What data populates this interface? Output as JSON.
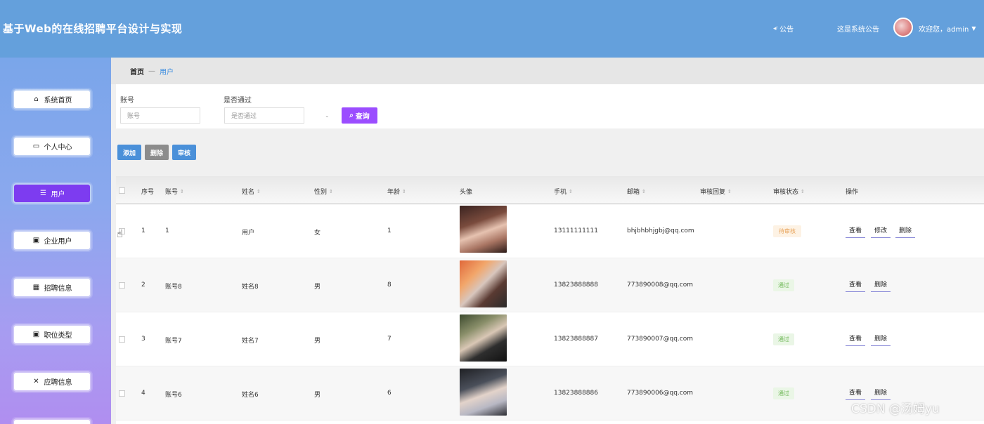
{
  "header": {
    "app_title": "基于Web的在线招聘平台设计与实现",
    "notice_label": "公告",
    "notice_text": "这是系统公告",
    "welcome": "欢迎您，admin"
  },
  "sidebar": {
    "items": [
      {
        "label": "系统首页",
        "icon": "home-icon"
      },
      {
        "label": "个人中心",
        "icon": "card-icon"
      },
      {
        "label": "用户",
        "icon": "menu-icon"
      },
      {
        "label": "企业用户",
        "icon": "clipboard-icon"
      },
      {
        "label": "招聘信息",
        "icon": "grid-icon"
      },
      {
        "label": "职位类型",
        "icon": "clipboard-icon"
      },
      {
        "label": "应聘信息",
        "icon": "ticket-icon"
      }
    ]
  },
  "breadcrumb": {
    "home": "首页",
    "separator": "—",
    "current": "用户"
  },
  "search": {
    "account_label": "账号",
    "account_placeholder": "账号",
    "passed_label": "是否通过",
    "passed_placeholder": "是否通过",
    "search_button": "查询"
  },
  "actions": {
    "add": "添加",
    "delete": "删除",
    "audit": "审核"
  },
  "table": {
    "columns": [
      "序号",
      "账号",
      "姓名",
      "性别",
      "年龄",
      "头像",
      "手机",
      "邮箱",
      "审核回复",
      "审核状态",
      "操作"
    ],
    "rows": [
      {
        "index": "1",
        "account": "1",
        "name": "用户",
        "gender": "女",
        "age": "1",
        "phone": "13111111111",
        "email": "bhjbhbhjgbj@qq.com",
        "reply": "",
        "status": "待审核",
        "status_color": "#e8a35a",
        "ops": [
          "查看",
          "修改",
          "删除"
        ]
      },
      {
        "index": "2",
        "account": "账号8",
        "name": "姓名8",
        "gender": "男",
        "age": "8",
        "phone": "13823888888",
        "email": "773890008@qq.com",
        "reply": "",
        "status": "通过",
        "status_color": "#72b95b",
        "ops": [
          "查看",
          "删除"
        ]
      },
      {
        "index": "3",
        "account": "账号7",
        "name": "姓名7",
        "gender": "男",
        "age": "7",
        "phone": "13823888887",
        "email": "773890007@qq.com",
        "reply": "",
        "status": "通过",
        "status_color": "#72b95b",
        "ops": [
          "查看",
          "删除"
        ]
      },
      {
        "index": "4",
        "account": "账号6",
        "name": "姓名6",
        "gender": "男",
        "age": "6",
        "phone": "13823888886",
        "email": "773890006@qq.com",
        "reply": "",
        "status": "通过",
        "status_color": "#72b95b",
        "ops": [
          "查看",
          "删除"
        ]
      }
    ]
  },
  "watermark": "CSDN @汤姆yu"
}
